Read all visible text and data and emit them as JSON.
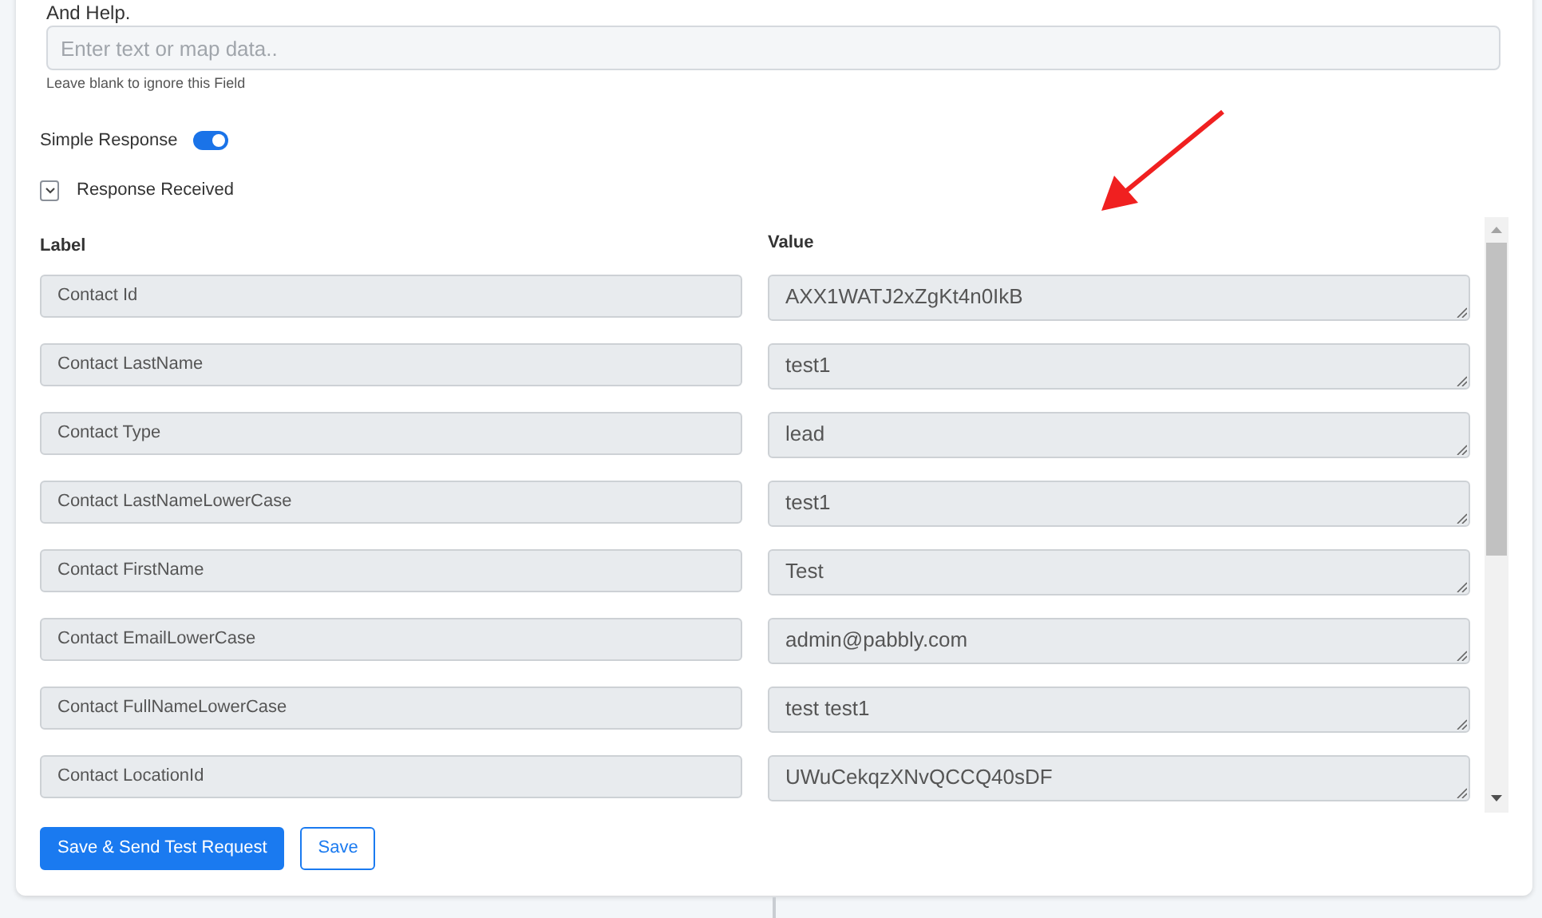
{
  "field": {
    "label": "And Help.",
    "placeholder": "Enter text or map data..",
    "hint": "Leave blank to ignore this Field"
  },
  "simple_response": {
    "label": "Simple Response",
    "on": true
  },
  "response_received": {
    "label": "Response Received",
    "expanded": true
  },
  "columns": [
    "Label",
    "Value"
  ],
  "rows": [
    {
      "label": "Contact Id",
      "value": "AXX1WATJ2xZgKt4n0IkB"
    },
    {
      "label": "Contact LastName",
      "value": "test1"
    },
    {
      "label": "Contact Type",
      "value": "lead"
    },
    {
      "label": "Contact LastNameLowerCase",
      "value": "test1"
    },
    {
      "label": "Contact FirstName",
      "value": "Test"
    },
    {
      "label": "Contact EmailLowerCase",
      "value": "admin@pabbly.com"
    },
    {
      "label": "Contact FullNameLowerCase",
      "value": "test test1"
    },
    {
      "label": "Contact LocationId",
      "value": "UWuCekqzXNvQCCQ40sDF"
    }
  ],
  "buttons": [
    {
      "label": "Save & Send Test Request",
      "kind": "primary"
    },
    {
      "label": "Save",
      "kind": "outline"
    }
  ]
}
